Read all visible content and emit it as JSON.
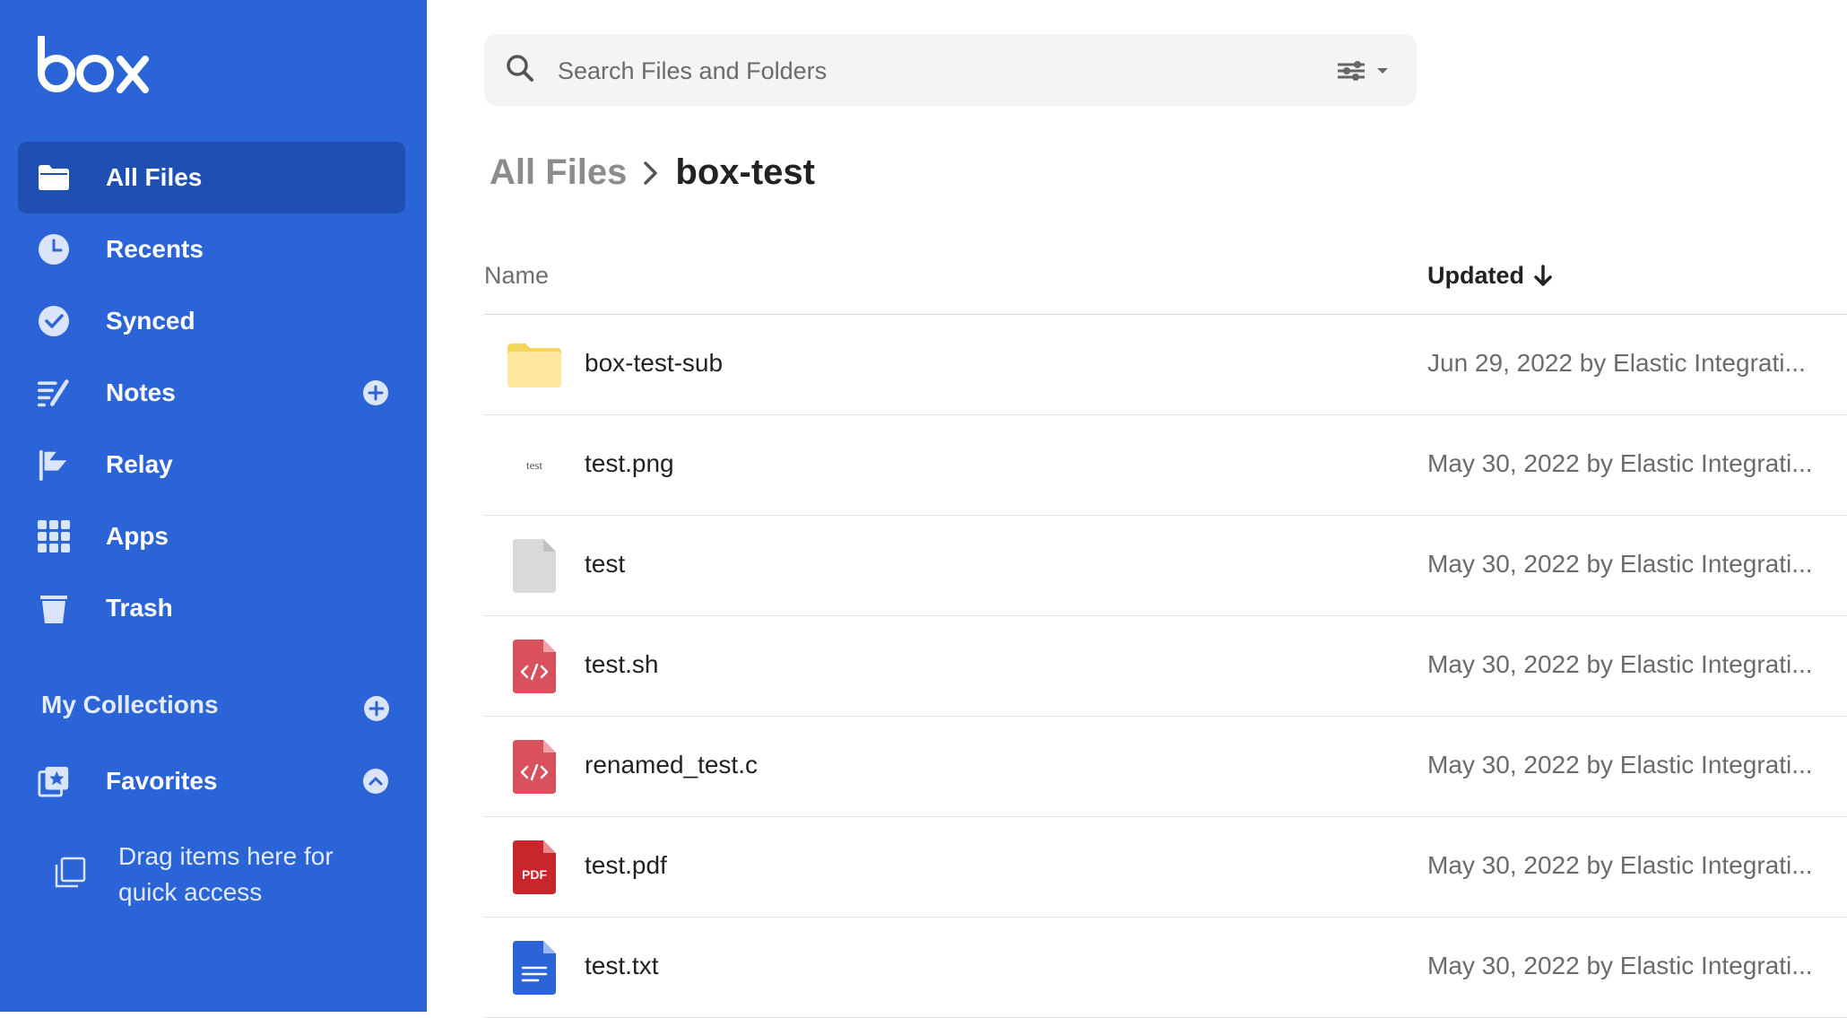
{
  "brand": {
    "logo_text": "box"
  },
  "sidebar": {
    "items": [
      {
        "label": "All Files",
        "icon": "folder-icon"
      },
      {
        "label": "Recents",
        "icon": "clock-icon"
      },
      {
        "label": "Synced",
        "icon": "check-circle-icon"
      },
      {
        "label": "Notes",
        "icon": "notes-icon"
      },
      {
        "label": "Relay",
        "icon": "relay-icon"
      },
      {
        "label": "Apps",
        "icon": "grid-icon"
      },
      {
        "label": "Trash",
        "icon": "trash-icon"
      }
    ],
    "collections_title": "My Collections",
    "favorites_label": "Favorites",
    "drag_hint": "Drag items here for quick access"
  },
  "search": {
    "placeholder": "Search Files and Folders"
  },
  "breadcrumb": {
    "root": "All Files",
    "current": "box-test"
  },
  "table": {
    "columns": {
      "name": "Name",
      "updated": "Updated"
    },
    "rows": [
      {
        "name": "box-test-sub",
        "updated": "Jun 29, 2022 by Elastic Integrati...",
        "type": "folder"
      },
      {
        "name": "test.png",
        "updated": "May 30, 2022 by Elastic Integrati...",
        "type": "image",
        "thumb_text": "test"
      },
      {
        "name": "test",
        "updated": "May 30, 2022 by Elastic Integrati...",
        "type": "generic"
      },
      {
        "name": "test.sh",
        "updated": "May 30, 2022 by Elastic Integrati...",
        "type": "code"
      },
      {
        "name": "renamed_test.c",
        "updated": "May 30, 2022 by Elastic Integrati...",
        "type": "code"
      },
      {
        "name": "test.pdf",
        "updated": "May 30, 2022 by Elastic Integrati...",
        "type": "pdf",
        "badge": "PDF"
      },
      {
        "name": "test.txt",
        "updated": "May 30, 2022 by Elastic Integrati...",
        "type": "text"
      }
    ]
  },
  "colors": {
    "sidebar_bg": "#2b64d6",
    "sidebar_active": "#1f4fb0",
    "folder_yellow": "#fbe48e",
    "code_red": "#d9515d",
    "pdf_red": "#c9252d",
    "text_blue": "#2b64d6"
  }
}
